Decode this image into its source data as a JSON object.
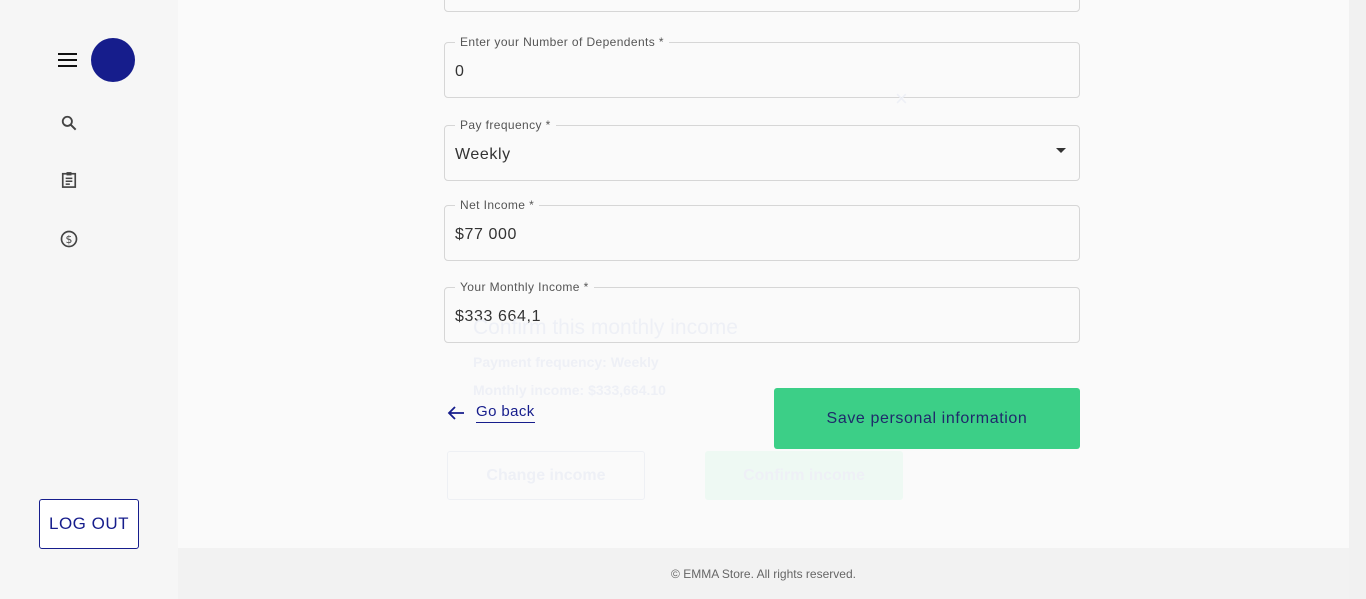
{
  "sidebar": {
    "logout": "LOG OUT"
  },
  "form": {
    "dependents": {
      "label": "Enter your Number of Dependents *",
      "value": "0"
    },
    "pay_frequency": {
      "label": "Pay frequency *",
      "value": "Weekly"
    },
    "net_income": {
      "label": "Net Income *",
      "value": "$77 000"
    },
    "monthly_income": {
      "label": "Your Monthly Income *",
      "value": "$333 664,1"
    },
    "go_back": "Go back",
    "save": "Save personal information"
  },
  "modal": {
    "title": "Confirm this monthly income",
    "frequency": "Payment frequency: Weekly",
    "income": "Monthly income: $333,664.10",
    "change": "Change income",
    "confirm": "Confirm income",
    "close": "×"
  },
  "footer": "© EMMA Store. All rights reserved."
}
